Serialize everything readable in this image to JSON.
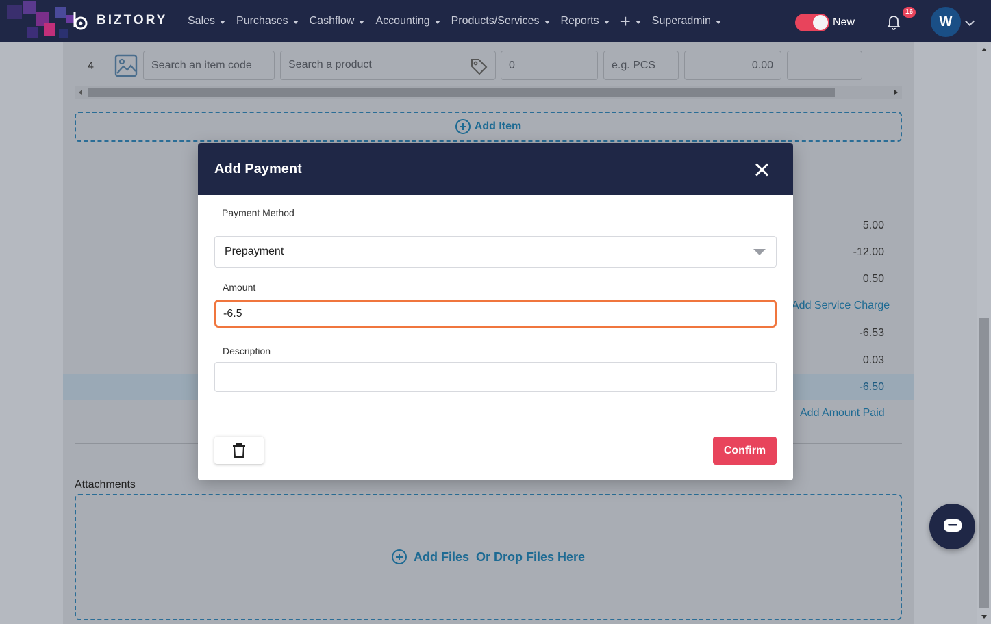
{
  "brand": {
    "name": "BIZTORY"
  },
  "nav": {
    "items": [
      "Sales",
      "Purchases",
      "Cashflow",
      "Accounting",
      "Products/Services",
      "Reports"
    ],
    "user_menu": "Superadmin"
  },
  "toggle": {
    "label": "New",
    "on": true
  },
  "notifications": {
    "count": "16"
  },
  "avatar": {
    "initial": "W"
  },
  "item_row": {
    "number": "4",
    "item_code_placeholder": "Search an item code",
    "product_placeholder": "Search a product",
    "quantity": "0",
    "unit_placeholder": "e.g. PCS",
    "price": "0.00"
  },
  "add_item_label": "Add Item",
  "totals": [
    "5.00",
    "-12.00",
    "0.50",
    "-6.53",
    "0.03",
    "-6.50"
  ],
  "links": {
    "add_service_charge": "Add Service Charge",
    "add_amount_paid": "Add Amount Paid"
  },
  "attachments": {
    "label": "Attachments",
    "add_files": "Add Files",
    "drop_text": "Or Drop Files Here"
  },
  "modal": {
    "title": "Add Payment",
    "payment_method_label": "Payment Method",
    "payment_method_value": "Prepayment",
    "amount_label": "Amount",
    "amount_value": "-6.5",
    "description_label": "Description",
    "description_value": "",
    "confirm_label": "Confirm"
  },
  "colors": {
    "nav_bg": "#1f2746",
    "accent": "#e8445c",
    "link": "#1d6a93",
    "focus": "#f0763e"
  }
}
